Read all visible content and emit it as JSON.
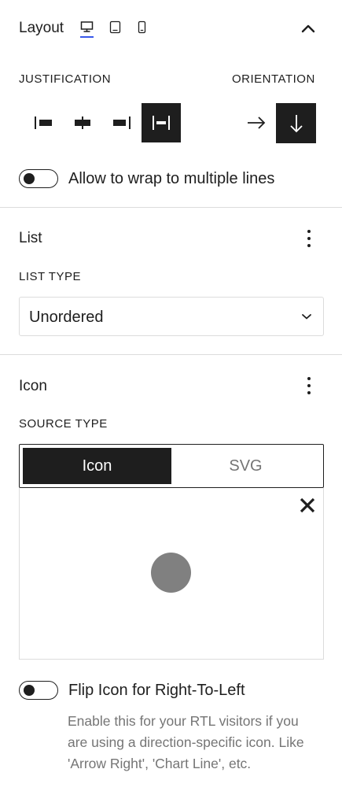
{
  "layout": {
    "title": "Layout",
    "devices": [
      "desktop-icon",
      "tablet-icon",
      "mobile-icon"
    ],
    "active_device": "desktop",
    "collapse_icon": "chevron-up-icon",
    "justification_label": "JUSTIFICATION",
    "justification_options": [
      "justify-left",
      "justify-center",
      "justify-right",
      "justify-space-between"
    ],
    "justification_selected": "justify-space-between",
    "orientation_label": "ORIENTATION",
    "orientation_options": [
      "horizontal",
      "vertical"
    ],
    "orientation_selected": "vertical",
    "wrap_toggle_label": "Allow to wrap to multiple lines",
    "wrap_toggle_on": false
  },
  "list": {
    "title": "List",
    "menu_icon": "more-vertical-icon",
    "list_type_label": "LIST TYPE",
    "list_type_value": "Unordered"
  },
  "icon": {
    "title": "Icon",
    "menu_icon": "more-vertical-icon",
    "source_type_label": "SOURCE TYPE",
    "source_options": [
      "Icon",
      "SVG"
    ],
    "source_selected": "Icon",
    "flip_toggle_label": "Flip Icon for Right-To-Left",
    "flip_toggle_on": false,
    "flip_help": "Enable this for your RTL visitors if you are using a direction-specific icon. Like 'Arrow Right', 'Chart Line', etc."
  },
  "colors": {
    "text": "#1e1e1e",
    "accent": "#3858e9",
    "muted": "#757575",
    "border": "#dcdcdc",
    "preview_dot": "#808080"
  }
}
